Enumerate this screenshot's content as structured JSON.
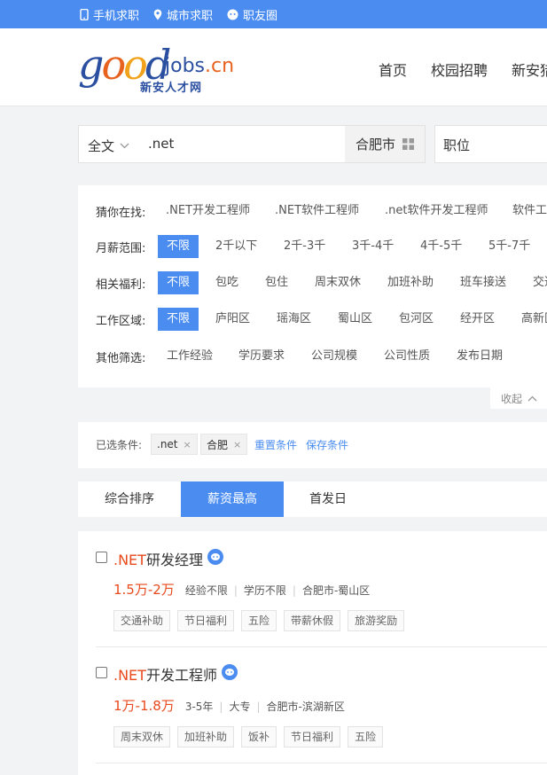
{
  "topbar": {
    "items": [
      {
        "label": "手机求职",
        "icon": "mobile-phone-icon"
      },
      {
        "label": "城市求职",
        "icon": "location-pin-icon"
      },
      {
        "label": "职友圈",
        "icon": "chat-face-icon"
      }
    ]
  },
  "logo": {
    "good": "good",
    "jobs": "jobs",
    "cn": ".cn",
    "subtitle": "新安人才网"
  },
  "nav": {
    "items": [
      "首页",
      "校园招聘",
      "新安猎"
    ]
  },
  "search": {
    "type_label": "全文",
    "keyword": ".net",
    "city": "合肥市",
    "position_label": "职位"
  },
  "filters": {
    "guess": {
      "label": "猜你在找:",
      "options": [
        ".NET开发工程师",
        ".NET软件工程师",
        ".net软件开发工程师",
        "软件工"
      ]
    },
    "salary": {
      "label": "月薪范围:",
      "options": [
        "不限",
        "2千以下",
        "2千-3千",
        "3千-4千",
        "4千-5千",
        "5千-7千"
      ]
    },
    "welfare": {
      "label": "相关福利:",
      "options": [
        "不限",
        "包吃",
        "包住",
        "周末双休",
        "加班补助",
        "班车接送",
        "交通"
      ]
    },
    "area": {
      "label": "工作区域:",
      "options": [
        "不限",
        "庐阳区",
        "瑶海区",
        "蜀山区",
        "包河区",
        "经开区",
        "高新区"
      ]
    },
    "other": {
      "label": "其他筛选:",
      "options": [
        "工作经验",
        "学历要求",
        "公司规模",
        "公司性质",
        "发布日期"
      ]
    },
    "collapse_label": "收起"
  },
  "selected": {
    "label": "已选条件:",
    "chips": [
      ".net",
      "合肥"
    ],
    "remove_symbol": "×",
    "reset_label": "重置条件",
    "save_label": "保存条件"
  },
  "sort": {
    "tabs": [
      "综合排序",
      "薪资最高",
      "首发日"
    ],
    "active": "薪资最高"
  },
  "jobs": [
    {
      "title_highlight": ".NET",
      "title_rest": "研发经理",
      "salary": "1.5万-2万",
      "experience": "经验不限",
      "education": "学历不限",
      "location": "合肥市-蜀山区",
      "tags": [
        "交通补助",
        "节日福利",
        "五险",
        "带薪休假",
        "旅游奖励"
      ]
    },
    {
      "title_highlight": ".NET",
      "title_rest": "开发工程师",
      "salary": "1万-1.8万",
      "experience": "3-5年",
      "education": "大专",
      "location": "合肥市-滨湖新区",
      "tags": [
        "周末双休",
        "加班补助",
        "饭补",
        "节日福利",
        "五险"
      ]
    }
  ],
  "separator": "|",
  "colors": {
    "accent": "#4a8cf0",
    "salary": "#e8491d",
    "brand_blue": "#2a4ea0",
    "brand_orange": "#e8621f"
  }
}
